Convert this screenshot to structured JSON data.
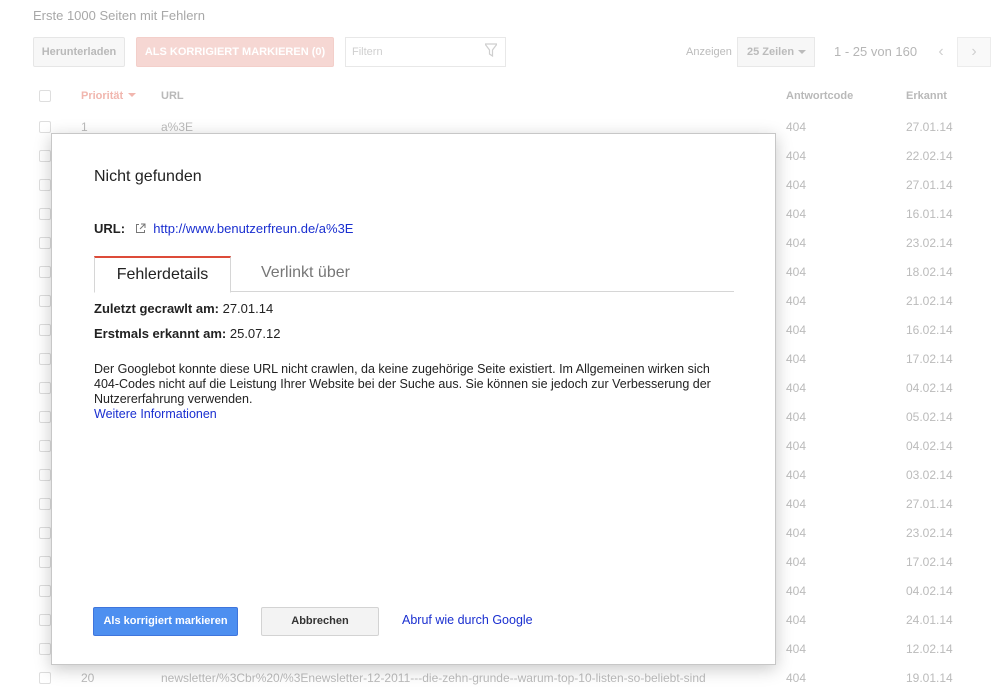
{
  "page": {
    "heading": "Erste 1000 Seiten mit Fehlern",
    "toolbar": {
      "download_label": "Herunterladen",
      "mark_fixed_label": "ALS KORRIGIERT MARKIEREN (0)",
      "filter_placeholder": "Filtern",
      "show_label": "Anzeigen",
      "rows_value": "25 Zeilen",
      "range_text": "1 - 25 von 160",
      "prev_symbol": "‹",
      "next_symbol": "›"
    },
    "table": {
      "headers": {
        "priority": "Priorität",
        "url": "URL",
        "response_code": "Antwortcode",
        "detected": "Erkannt"
      },
      "rows": [
        {
          "priority": "1",
          "url": "a%3E",
          "code": "404",
          "date": "27.01.14"
        },
        {
          "priority": "",
          "url": "",
          "code": "404",
          "date": "22.02.14"
        },
        {
          "priority": "",
          "url": "",
          "code": "404",
          "date": "27.01.14"
        },
        {
          "priority": "",
          "url": "",
          "code": "404",
          "date": "16.01.14"
        },
        {
          "priority": "",
          "url": "",
          "code": "404",
          "date": "23.02.14"
        },
        {
          "priority": "",
          "url": "",
          "code": "404",
          "date": "18.02.14"
        },
        {
          "priority": "",
          "url": "",
          "code": "404",
          "date": "21.02.14"
        },
        {
          "priority": "",
          "url": "",
          "code": "404",
          "date": "16.02.14"
        },
        {
          "priority": "",
          "url": "",
          "code": "404",
          "date": "17.02.14"
        },
        {
          "priority": "",
          "url": "",
          "code": "404",
          "date": "04.02.14"
        },
        {
          "priority": "",
          "url": "",
          "code": "404",
          "date": "05.02.14"
        },
        {
          "priority": "",
          "url": "",
          "code": "404",
          "date": "04.02.14"
        },
        {
          "priority": "",
          "url": "",
          "code": "404",
          "date": "03.02.14"
        },
        {
          "priority": "",
          "url": "",
          "code": "404",
          "date": "27.01.14"
        },
        {
          "priority": "",
          "url": "",
          "code": "404",
          "date": "23.02.14"
        },
        {
          "priority": "",
          "url": "",
          "code": "404",
          "date": "17.02.14"
        },
        {
          "priority": "",
          "url": "",
          "code": "404",
          "date": "04.02.14"
        },
        {
          "priority": "",
          "url": "",
          "code": "404",
          "date": "24.01.14"
        },
        {
          "priority": "",
          "url": "",
          "code": "404",
          "date": "12.02.14"
        },
        {
          "priority": "20",
          "url": "newsletter/%3Cbr%20/%3Enewsletter-12-2011---die-zehn-grunde--warum-top-10-listen-so-beliebt-sind",
          "code": "404",
          "date": "19.01.14"
        }
      ]
    }
  },
  "dialog": {
    "title": "Nicht gefunden",
    "url_label": "URL:",
    "url_value": "http://www.benutzerfreun.de/a%3E",
    "tabs": [
      "Fehlerdetails",
      "Verlinkt über"
    ],
    "last_crawled_label": "Zuletzt gecrawlt am:",
    "last_crawled_value": "27.01.14",
    "first_detected_label": "Erstmals erkannt am:",
    "first_detected_value": "25.07.12",
    "description": "Der Googlebot konnte diese URL nicht crawlen, da keine zugehörige Seite existiert. Im Allgemeinen wirken sich 404-Codes nicht auf die Leistung Ihrer Website bei der Suche aus. Sie können sie jedoch zur Verbesserung der Nutzererfahrung verwenden.",
    "more_info_link": "Weitere Informationen",
    "primary_button": "Als korrigiert markieren",
    "cancel_button": "Abbrechen",
    "fetch_link": "Abruf wie durch Google"
  },
  "colors": {
    "accent_red": "#dd4b39",
    "primary_blue": "#4d8ff0",
    "link_blue": "#1a2fd0"
  },
  "icons": {
    "filter": "filter-funnel-icon",
    "external_link": "external-link-icon",
    "sort": "sort-down-icon"
  }
}
